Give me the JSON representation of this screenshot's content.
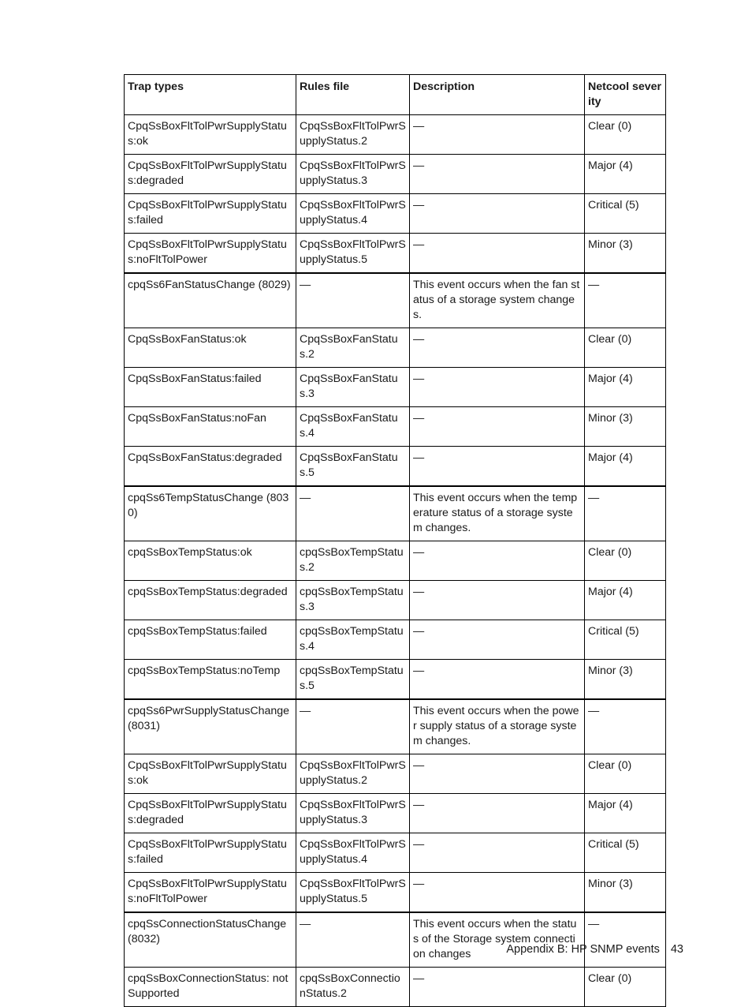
{
  "table": {
    "headers": [
      "Trap types",
      "Rules file",
      "Description",
      "Netcool severity"
    ],
    "rows": [
      {
        "group_start": false,
        "cells": [
          "CpqSsBoxFltTolPwrSupplyStatus:ok",
          "CpqSsBoxFltTolPwrSupplyStatus.2",
          "—",
          "Clear (0)"
        ]
      },
      {
        "group_start": false,
        "cells": [
          "CpqSsBoxFltTolPwrSupplyStatus:degraded",
          "CpqSsBoxFltTolPwrSupplyStatus.3",
          "—",
          "Major (4)"
        ]
      },
      {
        "group_start": false,
        "cells": [
          "CpqSsBoxFltTolPwrSupplyStatus:failed",
          "CpqSsBoxFltTolPwrSupplyStatus.4",
          "—",
          "Critical (5)"
        ]
      },
      {
        "group_start": false,
        "cells": [
          "CpqSsBoxFltTolPwrSupplyStatus:noFltTolPower",
          "CpqSsBoxFltTolPwrSupplyStatus.5",
          "—",
          "Minor (3)"
        ]
      },
      {
        "group_start": true,
        "cells": [
          "cpqSs6FanStatusChange (8029)",
          "—",
          "This event occurs when the fan status of a storage system changes.",
          "—"
        ]
      },
      {
        "group_start": false,
        "cells": [
          "CpqSsBoxFanStatus:ok",
          "CpqSsBoxFanStatus.2",
          "—",
          "Clear (0)"
        ]
      },
      {
        "group_start": false,
        "cells": [
          "CpqSsBoxFanStatus:failed",
          "CpqSsBoxFanStatus.3",
          "—",
          "Major (4)"
        ]
      },
      {
        "group_start": false,
        "cells": [
          "CpqSsBoxFanStatus:noFan",
          "CpqSsBoxFanStatus.4",
          "—",
          "Minor (3)"
        ]
      },
      {
        "group_start": false,
        "cells": [
          "CpqSsBoxFanStatus:degraded",
          "CpqSsBoxFanStatus.5",
          "—",
          "Major (4)"
        ]
      },
      {
        "group_start": true,
        "cells": [
          "cpqSs6TempStatusChange (8030)",
          "—",
          "This event occurs when the temperature status of a storage system changes.",
          "—"
        ]
      },
      {
        "group_start": false,
        "cells": [
          "cpqSsBoxTempStatus:ok",
          "cpqSsBoxTempStatus.2",
          "—",
          "Clear (0)"
        ]
      },
      {
        "group_start": false,
        "cells": [
          "cpqSsBoxTempStatus:degraded",
          "cpqSsBoxTempStatus.3",
          "—",
          "Major (4)"
        ]
      },
      {
        "group_start": false,
        "cells": [
          "cpqSsBoxTempStatus:failed",
          "cpqSsBoxTempStatus.4",
          "—",
          "Critical (5)"
        ]
      },
      {
        "group_start": false,
        "cells": [
          "cpqSsBoxTempStatus:noTemp",
          "cpqSsBoxTempStatus.5",
          "—",
          "Minor (3)"
        ]
      },
      {
        "group_start": true,
        "cells": [
          "cpqSs6PwrSupplyStatusChange (8031)",
          "—",
          "This event occurs when the power supply status of a storage system changes.",
          "—"
        ]
      },
      {
        "group_start": false,
        "cells": [
          "CpqSsBoxFltTolPwrSupplyStatus:ok",
          "CpqSsBoxFltTolPwrSupplyStatus.2",
          "—",
          "Clear (0)"
        ]
      },
      {
        "group_start": false,
        "cells": [
          "CpqSsBoxFltTolPwrSupplyStatus:degraded",
          "CpqSsBoxFltTolPwrSupplyStatus.3",
          "—",
          "Major (4)"
        ]
      },
      {
        "group_start": false,
        "cells": [
          "CpqSsBoxFltTolPwrSupplyStatus:failed",
          "CpqSsBoxFltTolPwrSupplyStatus.4",
          "—",
          "Critical (5)"
        ]
      },
      {
        "group_start": false,
        "cells": [
          "CpqSsBoxFltTolPwrSupplyStatus:noFltTolPower",
          "CpqSsBoxFltTolPwrSupplyStatus.5",
          "—",
          "Minor (3)"
        ]
      },
      {
        "group_start": true,
        "cells": [
          "cpqSsConnectionStatusChange(8032)",
          "—",
          "This event occurs when the status of the Storage system connection changes",
          "—"
        ]
      },
      {
        "group_start": false,
        "cells": [
          "cpqSsBoxConnectionStatus: notSupported",
          "cpqSsBoxConnectionStatus.2",
          "—",
          "Clear (0)"
        ]
      }
    ]
  },
  "footer": {
    "section": "Appendix B: HP SNMP events",
    "page_number": "43"
  }
}
